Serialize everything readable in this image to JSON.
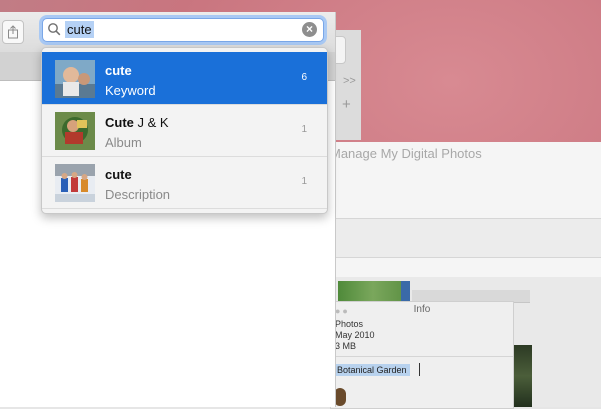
{
  "search": {
    "query": "cute"
  },
  "suggestions": [
    {
      "title_bold": "cute",
      "title_rest": "",
      "type": "Keyword",
      "count": "6",
      "selected": true
    },
    {
      "title_bold": "Cute",
      "title_rest": " J & K",
      "type": "Album",
      "count": "1",
      "selected": false
    },
    {
      "title_bold": "cute",
      "title_rest": "",
      "type": "Description",
      "count": "1",
      "selected": false
    }
  ],
  "background": {
    "article_text": "Manage My Digital Photos",
    "chevron": ">>",
    "plus": "+"
  },
  "info_panel": {
    "title": "Info",
    "line1": "Photos",
    "line2": "May 2010",
    "line3": "3 MB",
    "location": "Botanical Garden"
  },
  "colors": {
    "selection": "#1a70d9",
    "focus_ring": "#a9c9f4"
  }
}
